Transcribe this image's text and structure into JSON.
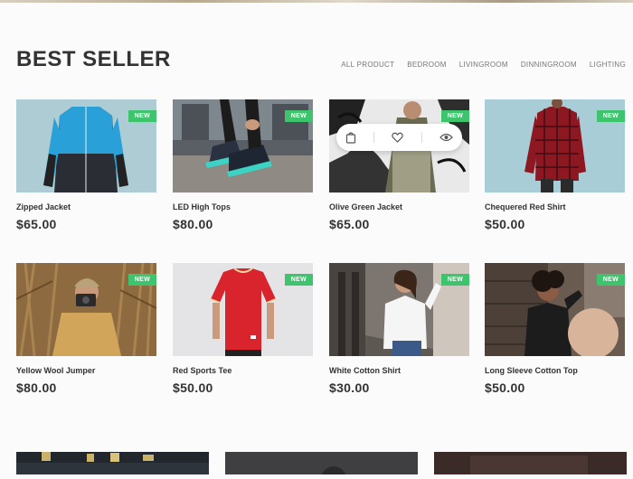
{
  "section_title": "BEST SELLER",
  "filters": [
    "ALL PRODUCT",
    "BEDROOM",
    "LIVINGROOM",
    "DINNINGROOM",
    "LIGHTING"
  ],
  "badge_label": "NEW",
  "products": [
    {
      "name": "Zipped Jacket",
      "price": "$65.00"
    },
    {
      "name": "LED High Tops",
      "price": "$80.00"
    },
    {
      "name": "Olive Green Jacket",
      "price": "$65.00"
    },
    {
      "name": "Chequered Red Shirt",
      "price": "$50.00"
    },
    {
      "name": "Yellow Wool Jumper",
      "price": "$80.00"
    },
    {
      "name": "Red Sports Tee",
      "price": "$50.00"
    },
    {
      "name": "White Cotton Shirt",
      "price": "$30.00"
    },
    {
      "name": "Long Sleeve Cotton Top",
      "price": "$50.00"
    }
  ],
  "hover_actions": [
    "cart-icon",
    "heart-icon",
    "eye-icon"
  ],
  "colors": {
    "badge": "#3ec46d",
    "text": "#333333"
  }
}
